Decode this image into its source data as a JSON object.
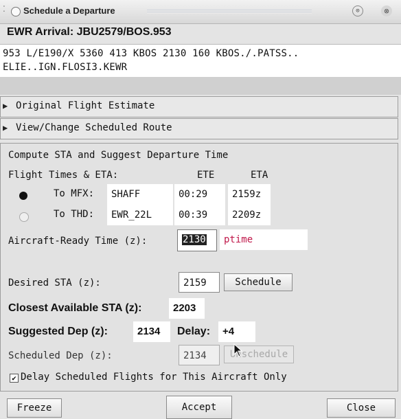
{
  "window": {
    "title": "Schedule a Departure",
    "minimize_glyph": "⊙",
    "close_glyph": "⊗"
  },
  "header": {
    "title": "EWR Arrival: JBU2579/BOS.953"
  },
  "route": {
    "line1": "953 L/E190/X 5360 413 KBOS 2130 160 KBOS./.PATSS..",
    "line2": "ELIE..IGN.FLOSI3.KEWR"
  },
  "sections": {
    "original": "Original Flight Estimate",
    "view_change": "View/Change Scheduled Route"
  },
  "compute": {
    "title": "Compute STA and Suggest Departure Time",
    "times_label": "Flight Times & ETA:",
    "ete_header": "ETE",
    "eta_header": "ETA",
    "rows": [
      {
        "label": "To MFX:",
        "fix": "SHAFF",
        "ete": "00:29",
        "eta": "2159z",
        "selected": true
      },
      {
        "label": "To THD:",
        "fix": "EWR_22L",
        "ete": "00:39",
        "eta": "2209z",
        "selected": false
      }
    ],
    "ready_label": "Aircraft-Ready Time (z):",
    "ready_value": "2130",
    "ready_hint": "ptime",
    "desired_label": "Desired STA (z):",
    "desired_value": "2159",
    "schedule_btn": "Schedule",
    "closest_label": "Closest Available STA (z):",
    "closest_value": "2203",
    "suggested_label": "Suggested Dep (z):",
    "suggested_value": "2134",
    "delay_label": "Delay:",
    "delay_value": "+4",
    "scheduled_label": "Scheduled Dep (z):",
    "scheduled_value": "2134",
    "unschedule_btn": "Unschedule",
    "delay_checkbox_label": "Delay Scheduled Flights for This Aircraft Only",
    "delay_checkbox_checked": true
  },
  "footer": {
    "freeze": "Freeze",
    "accept": "Accept",
    "close": "Close"
  },
  "colors": {
    "hint_text": "#c0184a",
    "selection": "#222222"
  }
}
